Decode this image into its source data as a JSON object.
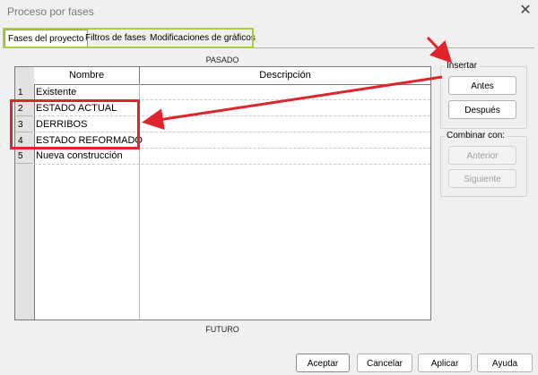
{
  "window": {
    "title": "Proceso por fases",
    "close_glyph": "✕"
  },
  "tabs": [
    {
      "label": "Fases del proyecto",
      "active": true
    },
    {
      "label": "Filtros de fases",
      "active": false
    },
    {
      "label": "Modificaciones de gráficos",
      "active": false
    }
  ],
  "table": {
    "top_label": "PASADO",
    "bottom_label": "FUTURO",
    "columns": [
      "Nombre",
      "Descripción"
    ],
    "rows": [
      {
        "num": "1",
        "name": "Existente",
        "description": ""
      },
      {
        "num": "2",
        "name": "ESTADO ACTUAL",
        "description": ""
      },
      {
        "num": "3",
        "name": "DERRIBOS",
        "description": ""
      },
      {
        "num": "4",
        "name": "ESTADO REFORMADO",
        "description": ""
      },
      {
        "num": "5",
        "name": "Nueva construcción",
        "description": ""
      }
    ]
  },
  "insert_group": {
    "label": "Insertar",
    "before": "Antes",
    "after": "Después"
  },
  "combine_group": {
    "label": "Combinar con:",
    "previous": "Anterior",
    "next": "Siguiente"
  },
  "footer": {
    "ok": "Aceptar",
    "cancel": "Cancelar",
    "apply": "Aplicar",
    "help": "Ayuda"
  },
  "colors": {
    "highlight_green": "#a6cf3a",
    "annotation_red": "#e0242c"
  }
}
